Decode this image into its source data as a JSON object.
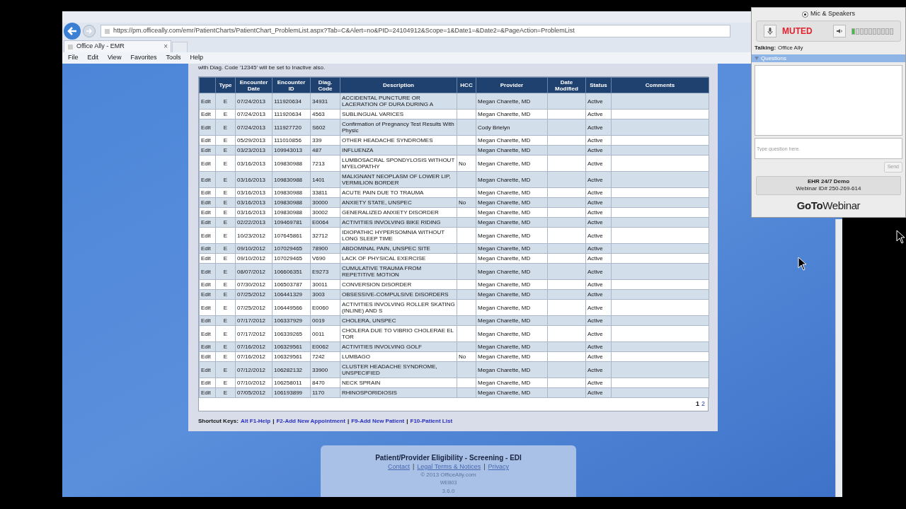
{
  "browser": {
    "url": "https://pm.officeally.com/emr/PatientCharts/PatientChart_ProblemList.aspx?Tab=C&Alert=no&PID=24104912&Scope=1&Date1=&Date2=&PageAction=ProblemList",
    "tab": "Office Ally - EMR",
    "tab_close": "×",
    "menu": [
      "File",
      "Edit",
      "View",
      "Favorites",
      "Tools",
      "Help"
    ]
  },
  "page": {
    "notice": "with Diag. Code '12345' will be set to Inactive also.",
    "table": {
      "columns": [
        "",
        "Type",
        "Encounter Date",
        "Encounter ID",
        "Diag. Code",
        "Description",
        "HCC",
        "Provider",
        "Date Modified",
        "Status",
        "Comments"
      ],
      "rows": [
        {
          "action": "Edit",
          "type": "E",
          "date": "07/24/2013",
          "id": "111920634",
          "code": "34931",
          "description": "ACCIDENTAL PUNCTURE OR LACERATION OF DURA DURING A",
          "provider": "Megan Charette, MD",
          "status": "Active"
        },
        {
          "action": "Edit",
          "type": "E",
          "date": "07/24/2013",
          "id": "111920634",
          "code": "4563",
          "description": "SUBLINGUAL VARICES",
          "provider": "Megan Charette, MD",
          "status": "Active"
        },
        {
          "action": "Edit",
          "type": "E",
          "date": "07/24/2013",
          "id": "111927720",
          "code": "S602",
          "description": "Confirmation of Pregnancy Test Results With Physic",
          "provider": "Cody Brielyn",
          "status": "Active"
        },
        {
          "action": "Edit",
          "type": "E",
          "date": "05/29/2013",
          "id": "111010856",
          "code": "339",
          "description": "OTHER HEADACHE SYNDROMES",
          "provider": "Megan Charette, MD",
          "status": "Active"
        },
        {
          "action": "Edit",
          "type": "E",
          "date": "03/23/2013",
          "id": "109943013",
          "code": "487",
          "description": "INFLUENZA",
          "provider": "Megan Charette, MD",
          "status": "Active"
        },
        {
          "action": "Edit",
          "type": "E",
          "date": "03/16/2013",
          "id": "109830988",
          "code": "7213",
          "description": "LUMBOSACRAL SPONDYLOSIS WITHOUT MYELOPATHY",
          "hcc": "No",
          "provider": "Megan Charette, MD",
          "status": "Active"
        },
        {
          "action": "Edit",
          "type": "E",
          "date": "03/16/2013",
          "id": "109830988",
          "code": "1401",
          "description": "MALIGNANT NEOPLASM OF LOWER LIP, VERMILION BORDER",
          "provider": "Megan Charette, MD",
          "status": "Active"
        },
        {
          "action": "Edit",
          "type": "E",
          "date": "03/16/2013",
          "id": "109830988",
          "code": "33811",
          "description": "ACUTE PAIN DUE TO TRAUMA",
          "provider": "Megan Charette, MD",
          "status": "Active"
        },
        {
          "action": "Edit",
          "type": "E",
          "date": "03/16/2013",
          "id": "109830988",
          "code": "30000",
          "description": "ANXIETY STATE, UNSPEC",
          "hcc": "No",
          "provider": "Megan Charette, MD",
          "status": "Active"
        },
        {
          "action": "Edit",
          "type": "E",
          "date": "03/16/2013",
          "id": "109830988",
          "code": "30002",
          "description": "GENERALIZED ANXIETY DISORDER",
          "provider": "Megan Charette, MD",
          "status": "Active"
        },
        {
          "action": "Edit",
          "type": "E",
          "date": "02/22/2013",
          "id": "109469781",
          "code": "E0064",
          "description": "ACTIVITIES INVOLVING BIKE RIDING",
          "provider": "Megan Charette, MD",
          "status": "Active"
        },
        {
          "action": "Edit",
          "type": "E",
          "date": "10/23/2012",
          "id": "107645861",
          "code": "32712",
          "description": "IDIOPATHIC HYPERSOMNIA WITHOUT LONG SLEEP TIME",
          "provider": "Megan Charette, MD",
          "status": "Active"
        },
        {
          "action": "Edit",
          "type": "E",
          "date": "09/10/2012",
          "id": "107029465",
          "code": "78900",
          "description": "ABDOMINAL PAIN, UNSPEC SITE",
          "provider": "Megan Charette, MD",
          "status": "Active"
        },
        {
          "action": "Edit",
          "type": "E",
          "date": "09/10/2012",
          "id": "107029465",
          "code": "V690",
          "description": "LACK OF PHYSICAL EXERCISE",
          "provider": "Megan Charette, MD",
          "status": "Active"
        },
        {
          "action": "Edit",
          "type": "E",
          "date": "08/07/2012",
          "id": "106606351",
          "code": "E9273",
          "description": "CUMULATIVE TRAUMA FROM REPETITIVE MOTION",
          "provider": "Megan Charette, MD",
          "status": "Active"
        },
        {
          "action": "Edit",
          "type": "E",
          "date": "07/30/2012",
          "id": "106503787",
          "code": "30011",
          "description": "CONVERSION DISORDER",
          "provider": "Megan Charette, MD",
          "status": "Active"
        },
        {
          "action": "Edit",
          "type": "E",
          "date": "07/25/2012",
          "id": "106441329",
          "code": "3003",
          "description": "OBSESSIVE-COMPULSIVE DISORDERS",
          "provider": "Megan Charette, MD",
          "status": "Active"
        },
        {
          "action": "Edit",
          "type": "E",
          "date": "07/25/2012",
          "id": "106449566",
          "code": "E0060",
          "description": "ACTIVITIES INVOLVING ROLLER SKATING (INLINE) AND S",
          "provider": "Megan Charette, MD",
          "status": "Active"
        },
        {
          "action": "Edit",
          "type": "E",
          "date": "07/17/2012",
          "id": "106337929",
          "code": "0019",
          "description": "CHOLERA, UNSPEC",
          "provider": "Megan Charette, MD",
          "status": "Active"
        },
        {
          "action": "Edit",
          "type": "E",
          "date": "07/17/2012",
          "id": "106339265",
          "code": "0011",
          "description": "CHOLERA DUE TO VIBRIO CHOLERAE EL TOR",
          "provider": "Megan Charette, MD",
          "status": "Active"
        },
        {
          "action": "Edit",
          "type": "E",
          "date": "07/16/2012",
          "id": "106329561",
          "code": "E0062",
          "description": "ACTIVITIES INVOLVING GOLF",
          "provider": "Megan Charette, MD",
          "status": "Active"
        },
        {
          "action": "Edit",
          "type": "E",
          "date": "07/16/2012",
          "id": "106329561",
          "code": "7242",
          "description": "LUMBAGO",
          "hcc": "No",
          "provider": "Megan Charette, MD",
          "status": "Active"
        },
        {
          "action": "Edit",
          "type": "E",
          "date": "07/12/2012",
          "id": "106282132",
          "code": "33900",
          "description": "CLUSTER HEADACHE SYNDROME, UNSPECIFIED",
          "provider": "Megan Charette, MD",
          "status": "Active"
        },
        {
          "action": "Edit",
          "type": "E",
          "date": "07/10/2012",
          "id": "106258011",
          "code": "8470",
          "description": "NECK SPRAIN",
          "provider": "Megan Charette, MD",
          "status": "Active"
        },
        {
          "action": "Edit",
          "type": "E",
          "date": "07/05/2012",
          "id": "106193899",
          "code": "1170",
          "description": "RHINOSPORIDIOSIS",
          "provider": "Megan Charette, MD",
          "status": "Active"
        }
      ],
      "pages": [
        {
          "label": "1",
          "selected": true
        },
        {
          "label": "2",
          "selected": false
        }
      ]
    },
    "shortcuts": {
      "label": "Shortcut Keys:",
      "separator": "|",
      "links": [
        "Alt F1-Help",
        "F2-Add New Appointment",
        "F9-Add New Patient",
        "F10-Patient List"
      ]
    }
  },
  "footer": {
    "title": "Patient/Provider Eligibility - Screening - EDI",
    "links": [
      "Contact",
      "Legal Terms & Notices",
      "Privacy"
    ],
    "separator": "|",
    "copyright": "© 2013 OfficeAlly.com",
    "server": "WEB03",
    "version": "3.6.0"
  },
  "webinar": {
    "audio_option": {
      "label": "Mic & Speakers",
      "selected": true
    },
    "mic_status": "MUTED",
    "level": 0.1,
    "talking_label": "Talking:",
    "talking": "Office Ally",
    "questions_header": "Questions",
    "question_placeholder": "Type question here.",
    "send": "Send",
    "title": "EHR 24/7 Demo",
    "webinar_id": "Webinar ID# 250-269-614",
    "logo": [
      "GoTo",
      "Webinar"
    ]
  }
}
